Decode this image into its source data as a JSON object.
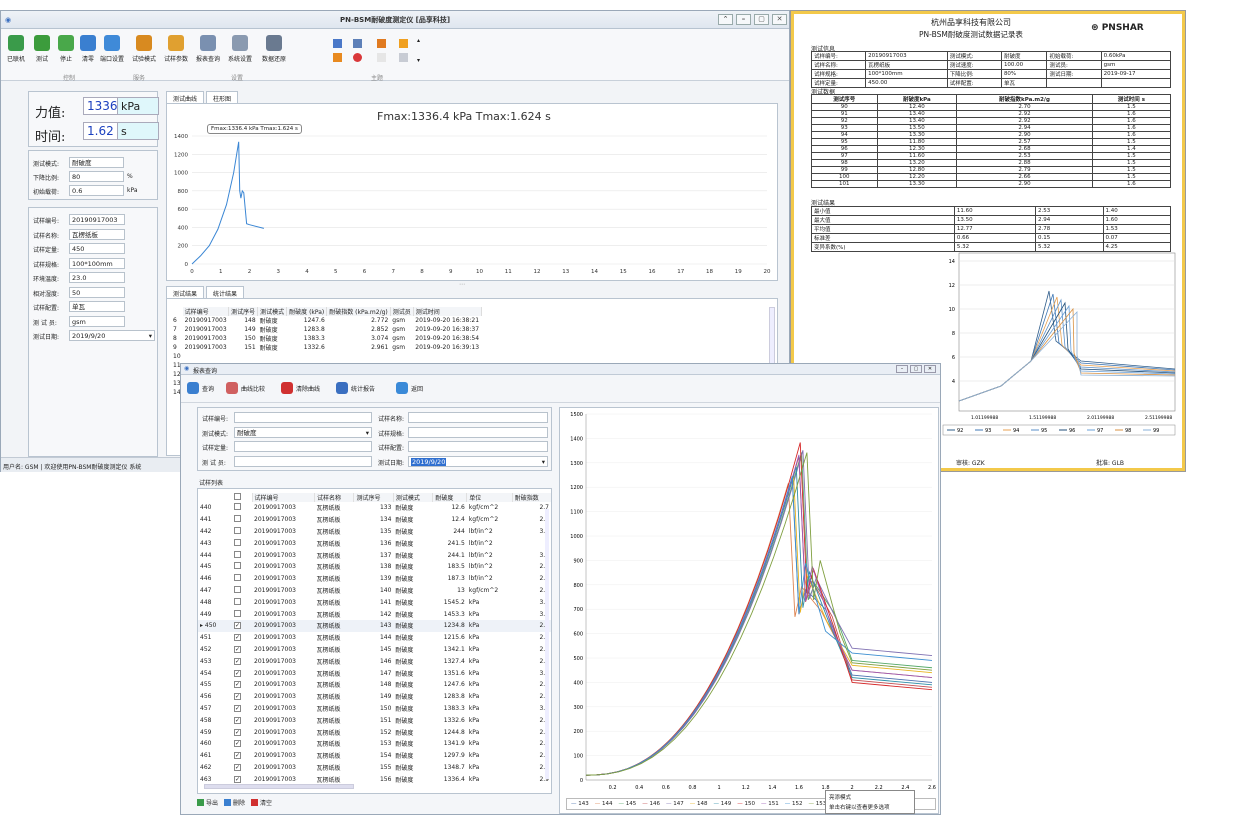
{
  "report": {
    "company": "杭州品享科技有限公司",
    "title": "PN-BSM耐破度测试数据记录表",
    "logo": "PNSHAR",
    "info_header": "测试信息",
    "info": [
      [
        "试样编号:",
        "20190917003",
        "测试模式:",
        "耐破度",
        "初始载荷:",
        "0.60kPa"
      ],
      [
        "试样名称:",
        "瓦楞纸板",
        "测试速度:",
        "100.00",
        "测试员:",
        "gsm"
      ],
      [
        "试样规格:",
        "100*100mm",
        "下降比例:",
        "80%",
        "测试日期:",
        "2019-09-17"
      ],
      [
        "试样定量:",
        "450.00",
        "试样配置:",
        "单瓦",
        "",
        ""
      ]
    ],
    "results_header": "测试数据",
    "cols": [
      "测试序号",
      "耐破度kPa",
      "耐破指数kPa.m2/g",
      "测试时间 s"
    ],
    "rows": [
      [
        "90",
        "12.40",
        "2.70",
        "1.5"
      ],
      [
        "91",
        "13.40",
        "2.92",
        "1.6"
      ],
      [
        "92",
        "13.40",
        "2.92",
        "1.6"
      ],
      [
        "93",
        "13.50",
        "2.94",
        "1.6"
      ],
      [
        "94",
        "13.30",
        "2.90",
        "1.6"
      ],
      [
        "95",
        "11.80",
        "2.57",
        "1.5"
      ],
      [
        "96",
        "12.30",
        "2.68",
        "1.4"
      ],
      [
        "97",
        "11.60",
        "2.53",
        "1.5"
      ],
      [
        "98",
        "13.20",
        "2.88",
        "1.5"
      ],
      [
        "99",
        "12.80",
        "2.79",
        "1.5"
      ],
      [
        "100",
        "12.20",
        "2.66",
        "1.5"
      ],
      [
        "101",
        "13.30",
        "2.90",
        "1.6"
      ]
    ],
    "stats_header": "测试结果",
    "stats": [
      [
        "最小值",
        "11.60",
        "2.53",
        "1.40"
      ],
      [
        "最大值",
        "13.50",
        "2.94",
        "1.60"
      ],
      [
        "平均值",
        "12.77",
        "2.78",
        "1.53"
      ],
      [
        "标准差",
        "0.66",
        "0.15",
        "0.07"
      ],
      [
        "变异系数(%)",
        "5.32",
        "5.32",
        "4.25"
      ]
    ],
    "y_ticks": [
      "14",
      "12",
      "10",
      "8",
      "6",
      "4"
    ],
    "x_ticks": [
      "1.01199988",
      "1.51199988",
      "2.01199988",
      "2.51199988"
    ],
    "legend": [
      "92",
      "93",
      "94",
      "95",
      "96",
      "97",
      "98",
      "99"
    ],
    "footer_left": "审核: GZK",
    "footer_right": "批准: GLB"
  },
  "main": {
    "title": "PN-BSM耐破度测定仪 [品享科技]",
    "toolbar": [
      {
        "label": "已联机",
        "color": "#3a9b4a"
      },
      {
        "label": "测试",
        "color": "#3c9c3c"
      },
      {
        "label": "停止",
        "color": "#49a84a"
      },
      {
        "label": "清零",
        "color": "#3a7fd0"
      },
      {
        "label": "端口设置",
        "color": "#3f8ad8"
      },
      {
        "label": "试验模式",
        "color": "#d88a20"
      },
      {
        "label": "试样参数",
        "color": "#e0a030"
      },
      {
        "label": "报表查询",
        "color": "#7a90b0"
      },
      {
        "label": "系统设置",
        "color": "#8a9ab0"
      },
      {
        "label": "数据还原",
        "color": "#6a7a90"
      }
    ],
    "groups": [
      "控制",
      "服务",
      "设置",
      "主题"
    ],
    "force_label": "力值:",
    "force_value": "1336.4",
    "force_unit": "kPa",
    "time_label": "时间:",
    "time_value": "1.62",
    "time_unit": "s",
    "mode_fields": [
      {
        "label": "测试模式:",
        "value": "耐破度",
        "unit": ""
      },
      {
        "label": "下降比例:",
        "value": "80",
        "unit": "%"
      },
      {
        "label": "初始载荷:",
        "value": "0.6",
        "unit": "kPa"
      }
    ],
    "sample_fields": [
      {
        "label": "试样编号:",
        "value": "20190917003"
      },
      {
        "label": "试样名称:",
        "value": "瓦楞纸板"
      },
      {
        "label": "试样定量:",
        "value": "450"
      },
      {
        "label": "试样规格:",
        "value": "100*100mm"
      },
      {
        "label": "环境温度:",
        "value": "23.0"
      },
      {
        "label": "相对湿度:",
        "value": "50"
      },
      {
        "label": "试样配置:",
        "value": "单瓦"
      },
      {
        "label": "测 试 员:",
        "value": "gsm"
      },
      {
        "label": "测试日期:",
        "value": "2019/9/20"
      }
    ],
    "chart_tabs": [
      "测试曲线",
      "柱形图"
    ],
    "chart_title": "Fmax:1336.4 kPa   Tmax:1.624 s",
    "tooltip": "Fmax:1336.4 kPa  Tmax:1.624 s",
    "result_tabs": [
      "测试结果",
      "统计结果"
    ],
    "result_cols": [
      "试样编号",
      "测试序号",
      "测试模式",
      "耐破度 (kPa)",
      "耐破指数 (kPa.m2/g)",
      "测试员",
      "测试时间"
    ],
    "result_rows": [
      [
        "6",
        "20190917003",
        "148",
        "耐破度",
        "1247.6",
        "2.772",
        "gsm",
        "2019-09-20 16:38:21"
      ],
      [
        "7",
        "20190917003",
        "149",
        "耐破度",
        "1283.8",
        "2.852",
        "gsm",
        "2019-09-20 16:38:37"
      ],
      [
        "8",
        "20190917003",
        "150",
        "耐破度",
        "1383.3",
        "3.074",
        "gsm",
        "2019-09-20 16:38:54"
      ],
      [
        "9",
        "20190917003",
        "151",
        "耐破度",
        "1332.6",
        "2.961",
        "gsm",
        "2019-09-20 16:39:13"
      ],
      [
        "10",
        "",
        "",
        "",
        "",
        "",
        "",
        ""
      ],
      [
        "11",
        "",
        "",
        "",
        "",
        "",
        "",
        ""
      ],
      [
        "12",
        "",
        "",
        "",
        "",
        "",
        "",
        ""
      ],
      [
        "13",
        "",
        "",
        "",
        "",
        "",
        "",
        ""
      ],
      [
        "14",
        "",
        "",
        "",
        "",
        "",
        "",
        ""
      ]
    ],
    "status": "用户名: GSM  |  欢迎使用PN-BSM耐破度测定仪  系统"
  },
  "query": {
    "title": "报表查询",
    "toolbar": [
      "查询",
      "曲线比较",
      "清除曲线",
      "统计报告",
      "返回"
    ],
    "fields_left": [
      {
        "label": "试样编号:",
        "value": ""
      },
      {
        "label": "测试模式:",
        "value": "耐破度"
      },
      {
        "label": "试样定量:",
        "value": ""
      },
      {
        "label": "测 试 员:",
        "value": ""
      }
    ],
    "fields_right": [
      {
        "label": "试样名称:",
        "value": ""
      },
      {
        "label": "试样规格:",
        "value": ""
      },
      {
        "label": "试样配置:",
        "value": ""
      },
      {
        "label": "测试日期:",
        "value": "2019/9/20"
      }
    ],
    "list_title": "试样列表",
    "list_cols": [
      "试样编号",
      "试样名称",
      "测试序号",
      "测试模式",
      "耐破度",
      "单位",
      "耐破指数"
    ],
    "list_rows": [
      [
        "440",
        false,
        "20190917003",
        "瓦楞纸板",
        "133",
        "耐破度",
        "12.6",
        "kgf/cm^2",
        "2.7"
      ],
      [
        "441",
        false,
        "20190917003",
        "瓦楞纸板",
        "134",
        "耐破度",
        "12.4",
        "kgf/cm^2",
        "2.7"
      ],
      [
        "442",
        false,
        "20190917003",
        "瓦楞纸板",
        "135",
        "耐破度",
        "244",
        "lbf/in^2",
        "3.7"
      ],
      [
        "443",
        false,
        "20190917003",
        "瓦楞纸板",
        "136",
        "耐破度",
        "241.5",
        "lbf/in^2",
        "3"
      ],
      [
        "444",
        false,
        "20190917003",
        "瓦楞纸板",
        "137",
        "耐破度",
        "244.1",
        "lbf/in^2",
        "3.7"
      ],
      [
        "445",
        false,
        "20190917003",
        "瓦楞纸板",
        "138",
        "耐破度",
        "183.5",
        "lbf/in^2",
        "2.8"
      ],
      [
        "446",
        false,
        "20190917003",
        "瓦楞纸板",
        "139",
        "耐破度",
        "187.3",
        "lbf/in^2",
        "2.8"
      ],
      [
        "447",
        false,
        "20190917003",
        "瓦楞纸板",
        "140",
        "耐破度",
        "13",
        "kgf/cm^2",
        "2.8"
      ],
      [
        "448",
        false,
        "20190917003",
        "瓦楞纸板",
        "141",
        "耐破度",
        "1545.2",
        "kPa",
        "3.4"
      ],
      [
        "449",
        false,
        "20190917003",
        "瓦楞纸板",
        "142",
        "耐破度",
        "1453.3",
        "kPa",
        "3.2"
      ],
      [
        "450",
        true,
        "20190917003",
        "瓦楞纸板",
        "143",
        "耐破度",
        "1234.8",
        "kPa",
        "2.7"
      ],
      [
        "451",
        true,
        "20190917003",
        "瓦楞纸板",
        "144",
        "耐破度",
        "1215.6",
        "kPa",
        "2.7"
      ],
      [
        "452",
        true,
        "20190917003",
        "瓦楞纸板",
        "145",
        "耐破度",
        "1342.1",
        "kPa",
        "2.9"
      ],
      [
        "453",
        true,
        "20190917003",
        "瓦楞纸板",
        "146",
        "耐破度",
        "1327.4",
        "kPa",
        "2.9"
      ],
      [
        "454",
        true,
        "20190917003",
        "瓦楞纸板",
        "147",
        "耐破度",
        "1351.6",
        "kPa",
        "3.0"
      ],
      [
        "455",
        true,
        "20190917003",
        "瓦楞纸板",
        "148",
        "耐破度",
        "1247.6",
        "kPa",
        "2.7"
      ],
      [
        "456",
        true,
        "20190917003",
        "瓦楞纸板",
        "149",
        "耐破度",
        "1283.8",
        "kPa",
        "2.8"
      ],
      [
        "457",
        true,
        "20190917003",
        "瓦楞纸板",
        "150",
        "耐破度",
        "1383.3",
        "kPa",
        "3.0"
      ],
      [
        "458",
        true,
        "20190917003",
        "瓦楞纸板",
        "151",
        "耐破度",
        "1332.6",
        "kPa",
        "2.9"
      ],
      [
        "459",
        true,
        "20190917003",
        "瓦楞纸板",
        "152",
        "耐破度",
        "1244.8",
        "kPa",
        "2.7"
      ],
      [
        "460",
        true,
        "20190917003",
        "瓦楞纸板",
        "153",
        "耐破度",
        "1341.9",
        "kPa",
        "2.9"
      ],
      [
        "461",
        true,
        "20190917003",
        "瓦楞纸板",
        "154",
        "耐破度",
        "1297.9",
        "kPa",
        "2.8"
      ],
      [
        "462",
        true,
        "20190917003",
        "瓦楞纸板",
        "155",
        "耐破度",
        "1348.7",
        "kPa",
        "2.9"
      ],
      [
        "463",
        true,
        "20190917003",
        "瓦楞纸板",
        "156",
        "耐破度",
        "1336.4",
        "kPa",
        "2.9"
      ]
    ],
    "buttons": [
      "导出",
      "删除",
      "清空"
    ],
    "legend": [
      "143",
      "144",
      "145",
      "146",
      "147",
      "148",
      "149",
      "150",
      "151",
      "152",
      "153"
    ],
    "popup_lines": [
      "亮添模式",
      "单击右键以查看更多选项"
    ]
  },
  "chart_data": [
    {
      "type": "line",
      "xlim": [
        0,
        20
      ],
      "ylim": [
        0,
        1400
      ],
      "x_ticks": [
        0,
        1,
        2,
        3,
        4,
        5,
        6,
        7,
        8,
        9,
        10,
        11,
        12,
        13,
        14,
        15,
        16,
        17,
        18,
        19,
        20
      ],
      "y_ticks": [
        0,
        200,
        400,
        600,
        800,
        1000,
        1200,
        1400
      ],
      "series": [
        {
          "x": [
            0,
            0.3,
            0.6,
            0.9,
            1.2,
            1.45,
            1.624,
            1.66,
            1.7,
            1.75,
            1.8,
            1.9,
            2.0,
            2.5
          ],
          "y": [
            0,
            90,
            200,
            380,
            650,
            1000,
            1336.4,
            800,
            720,
            800,
            780,
            440,
            430,
            390
          ]
        }
      ]
    },
    {
      "type": "line",
      "xlim": [
        0,
        2.6
      ],
      "ylim": [
        0,
        1500
      ],
      "x_ticks": [
        0.2,
        0.4,
        0.6,
        0.8,
        1,
        1.2,
        1.4,
        1.6,
        1.8,
        2,
        2.2,
        2.4,
        2.6
      ],
      "y_ticks": [
        0,
        100,
        200,
        300,
        400,
        500,
        600,
        700,
        800,
        900,
        1000,
        1100,
        1200,
        1300,
        1400,
        1500
      ],
      "series": [
        {
          "name": "143",
          "color": "#4c72b0",
          "peak": 1234.8,
          "tpeak": 1.55,
          "end": 400
        },
        {
          "name": "144",
          "color": "#dd8452",
          "peak": 1215.6,
          "tpeak": 1.52,
          "end": 420
        },
        {
          "name": "145",
          "color": "#55a868",
          "peak": 1342.1,
          "tpeak": 1.62,
          "end": 460
        },
        {
          "name": "146",
          "color": "#c44e52",
          "peak": 1327.4,
          "tpeak": 1.6,
          "end": 380
        },
        {
          "name": "147",
          "color": "#8172b3",
          "peak": 1351.6,
          "tpeak": 1.63,
          "end": 510
        },
        {
          "name": "148",
          "color": "#e8b422",
          "peak": 1247.6,
          "tpeak": 1.56,
          "end": 440
        },
        {
          "name": "149",
          "color": "#2f8fa8",
          "peak": 1283.8,
          "tpeak": 1.58,
          "end": 390
        },
        {
          "name": "150",
          "color": "#d62728",
          "peak": 1383.3,
          "tpeak": 1.61,
          "end": 370
        },
        {
          "name": "151",
          "color": "#9b59b6",
          "peak": 1332.6,
          "tpeak": 1.6,
          "end": 420
        },
        {
          "name": "152",
          "color": "#3b8ed0",
          "peak": 1244.8,
          "tpeak": 1.55,
          "end": 490
        },
        {
          "name": "153",
          "color": "#7f9f3f",
          "peak": 1341.9,
          "tpeak": 1.66,
          "end": 450
        }
      ]
    }
  ]
}
